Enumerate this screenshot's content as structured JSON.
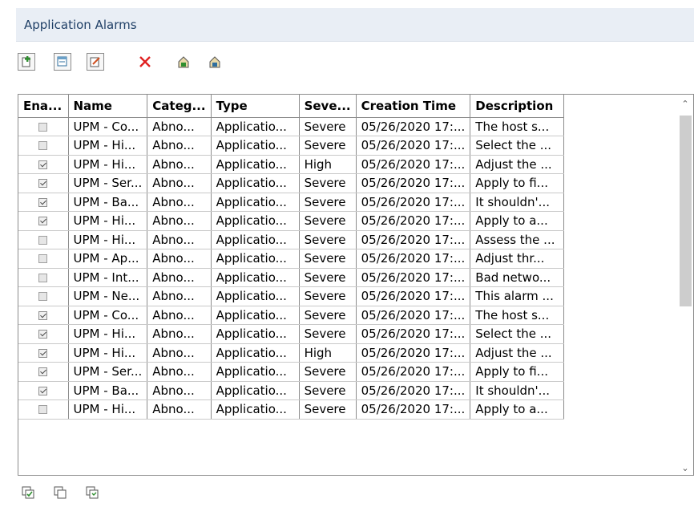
{
  "header": {
    "title": "Application Alarms"
  },
  "toolbar": {
    "buttons": [
      {
        "icon": "add-icon"
      },
      {
        "icon": "copy-icon"
      },
      {
        "icon": "edit-icon"
      },
      {
        "icon": "delete-icon"
      },
      {
        "icon": "export-icon"
      },
      {
        "icon": "import-icon"
      }
    ]
  },
  "table": {
    "columns": [
      "Ena...",
      "Name",
      "Categ...",
      "Type",
      "Seve...",
      "Creation Time",
      "Description"
    ],
    "rows": [
      {
        "enabled": false,
        "name": "UPM - Co...",
        "category": "Abno...",
        "type": "Applicatio...",
        "severity": "Severe",
        "created": "05/26/2020 17:...",
        "description": "The host s..."
      },
      {
        "enabled": false,
        "name": "UPM - Hi...",
        "category": "Abno...",
        "type": "Applicatio...",
        "severity": "Severe",
        "created": "05/26/2020 17:...",
        "description": "Select the ..."
      },
      {
        "enabled": true,
        "name": "UPM - Hi...",
        "category": "Abno...",
        "type": "Applicatio...",
        "severity": "High",
        "created": "05/26/2020 17:...",
        "description": "Adjust the ..."
      },
      {
        "enabled": true,
        "name": "UPM - Ser...",
        "category": "Abno...",
        "type": "Applicatio...",
        "severity": "Severe",
        "created": "05/26/2020 17:...",
        "description": "Apply to fi..."
      },
      {
        "enabled": true,
        "name": "UPM - Ba...",
        "category": "Abno...",
        "type": "Applicatio...",
        "severity": "Severe",
        "created": "05/26/2020 17:...",
        "description": "It shouldn'..."
      },
      {
        "enabled": true,
        "name": "UPM - Hi...",
        "category": "Abno...",
        "type": "Applicatio...",
        "severity": "Severe",
        "created": "05/26/2020 17:...",
        "description": "Apply to a..."
      },
      {
        "enabled": false,
        "name": "UPM - Hi...",
        "category": "Abno...",
        "type": "Applicatio...",
        "severity": "Severe",
        "created": "05/26/2020 17:...",
        "description": "Assess the ..."
      },
      {
        "enabled": false,
        "name": "UPM - Ap...",
        "category": "Abno...",
        "type": "Applicatio...",
        "severity": "Severe",
        "created": "05/26/2020 17:...",
        "description": "Adjust thr..."
      },
      {
        "enabled": false,
        "name": "UPM - Int...",
        "category": "Abno...",
        "type": "Applicatio...",
        "severity": "Severe",
        "created": "05/26/2020 17:...",
        "description": "Bad netwo..."
      },
      {
        "enabled": false,
        "name": "UPM - Ne...",
        "category": "Abno...",
        "type": "Applicatio...",
        "severity": "Severe",
        "created": "05/26/2020 17:...",
        "description": "This alarm ..."
      },
      {
        "enabled": true,
        "name": "UPM - Co...",
        "category": "Abno...",
        "type": "Applicatio...",
        "severity": "Severe",
        "created": "05/26/2020 17:...",
        "description": "The host s..."
      },
      {
        "enabled": true,
        "name": "UPM - Hi...",
        "category": "Abno...",
        "type": "Applicatio...",
        "severity": "Severe",
        "created": "05/26/2020 17:...",
        "description": "Select the ..."
      },
      {
        "enabled": true,
        "name": "UPM - Hi...",
        "category": "Abno...",
        "type": "Applicatio...",
        "severity": "High",
        "created": "05/26/2020 17:...",
        "description": "Adjust the ..."
      },
      {
        "enabled": true,
        "name": "UPM - Ser...",
        "category": "Abno...",
        "type": "Applicatio...",
        "severity": "Severe",
        "created": "05/26/2020 17:...",
        "description": "Apply to fi..."
      },
      {
        "enabled": true,
        "name": "UPM - Ba...",
        "category": "Abno...",
        "type": "Applicatio...",
        "severity": "Severe",
        "created": "05/26/2020 17:...",
        "description": "It shouldn'..."
      },
      {
        "enabled": false,
        "name": "UPM - Hi...",
        "category": "Abno...",
        "type": "Applicatio...",
        "severity": "Severe",
        "created": "05/26/2020 17:...",
        "description": "Apply to a..."
      }
    ]
  },
  "bottom_toolbar": {
    "buttons": [
      {
        "icon": "enable-all-icon"
      },
      {
        "icon": "disable-all-icon"
      },
      {
        "icon": "refresh-icon"
      }
    ]
  },
  "colors": {
    "header_bg": "#e9eef5",
    "title": "#1f3f66",
    "delete_red": "#e02020",
    "icon_green": "#2f8f2f"
  }
}
